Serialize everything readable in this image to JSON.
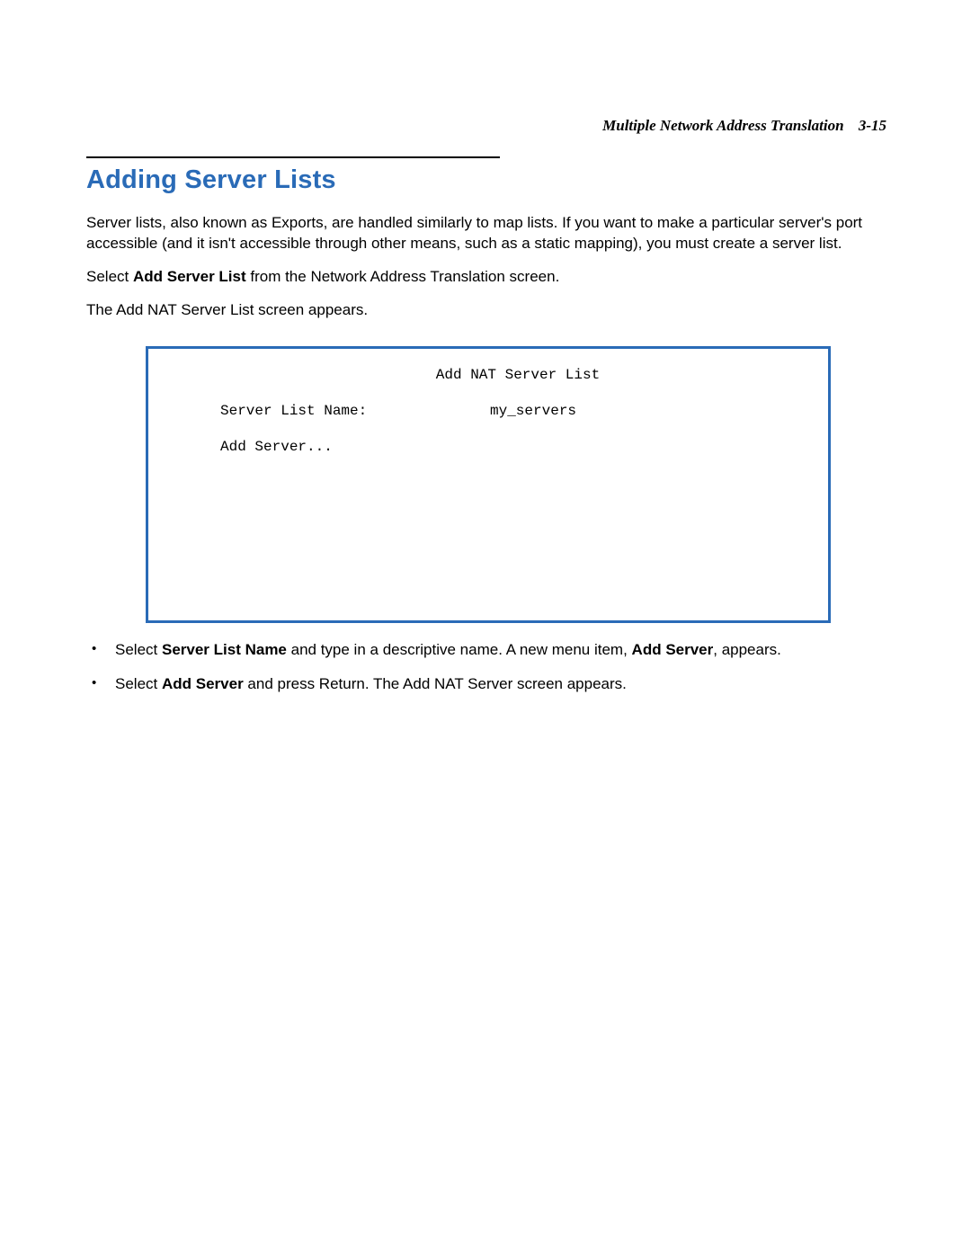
{
  "header": {
    "section": "Multiple Network Address Translation",
    "pageNumber": "3-15"
  },
  "title": "Adding Server Lists",
  "paragraphs": {
    "p1": "Server lists, also known as Exports, are handled similarly to map lists. If you want to make a particular server's port accessible (and it isn't accessible through other means, such as a static mapping), you must create a server list.",
    "p2_pre": "Select ",
    "p2_bold": "Add Server List",
    "p2_post": " from the Network Address Translation screen.",
    "p3": "The Add NAT Server List screen appears."
  },
  "figure": {
    "title": "Add NAT Server List",
    "row1_label": "Server List Name:",
    "row1_value": "my_servers",
    "row2": "Add Server..."
  },
  "bullets": {
    "b1_pre": "Select ",
    "b1_bold1": "Server List Name",
    "b1_mid": " and type in a descriptive name. A new menu item, ",
    "b1_bold2": "Add Server",
    "b1_post": ", appears.",
    "b2_pre": "Select ",
    "b2_bold": "Add Server",
    "b2_post": " and press Return. The Add NAT Server screen appears."
  }
}
